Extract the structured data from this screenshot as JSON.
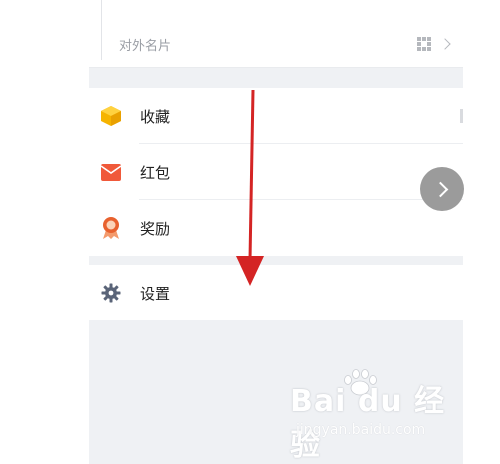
{
  "profile": {
    "namecard_label": "对外名片"
  },
  "menu": {
    "items": [
      {
        "label": "收藏",
        "icon": "favorites-cube-icon",
        "color": "#f6b400"
      },
      {
        "label": "红包",
        "icon": "red-envelope-icon",
        "color": "#f0593a"
      },
      {
        "label": "奖励",
        "icon": "reward-medal-icon",
        "color": "#e8612e"
      }
    ],
    "settings": {
      "label": "设置",
      "icon": "gear-icon",
      "color": "#5a6478"
    }
  },
  "watermark": {
    "brand": "Bai du 经验",
    "url": "jingyan.baidu.com"
  },
  "colors": {
    "background": "#eff1f4",
    "annotation_arrow": "#d42424"
  }
}
